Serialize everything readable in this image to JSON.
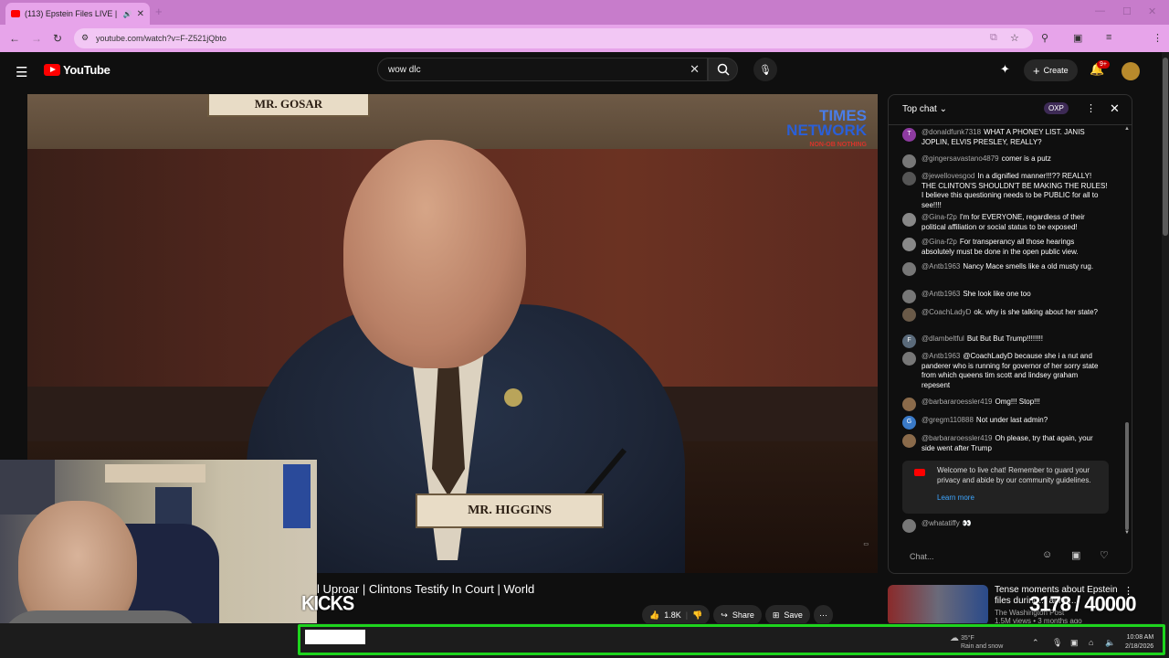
{
  "browser": {
    "tab_title": "(113) Epstein Files LIVE | Cli",
    "url": "youtube.com/watch?v=F-Z521jQbto"
  },
  "youtube": {
    "logo_text": "YouTube",
    "search_value": "wow dlc",
    "create_label": "Create",
    "notif_count": "9+"
  },
  "video": {
    "nameplate_top": "MR. GOSAR",
    "nameplate_bottom": "MR. HIGGINS",
    "brand_line1": "TIMES",
    "brand_line2": "NETWORK",
    "brand_tag": "NON-OB NOTHING"
  },
  "below_video": {
    "title": "l Uproar | Clintons Testify In Court | World",
    "overlay_label": "KICKS",
    "like_count": "1.8K",
    "share_label": "Share",
    "save_label": "Save"
  },
  "chat": {
    "header": "Top chat",
    "badge": "OXP",
    "input_placeholder": "Chat...",
    "messages": [
      {
        "initial": "T",
        "color": "#8e3ba1",
        "author": "@donaldfunk7318",
        "text": "WHAT A PHONEY LIST. JANIS JOPLIN, ELVIS PRESLEY, REALLY?"
      },
      {
        "initial": "",
        "color": "#777777",
        "author": "@gingersavastano4879",
        "text": "comer is a putz"
      },
      {
        "initial": "",
        "color": "#555555",
        "author": "@jewellovesgod",
        "text": "In a dignified manner!!!?? REALLY! THE CLINTON'S SHOULDN'T BE MAKING THE RULES! I believe this questioning needs to be PUBLIC for all to see!!!!"
      },
      {
        "initial": "",
        "color": "#888888",
        "author": "@Gina-f2p",
        "text": "I'm for EVERYONE, regardless of their political affiliation or social status to be exposed!"
      },
      {
        "initial": "",
        "color": "#888888",
        "author": "@Gina-f2p",
        "text": "For transperancy all those hearings absolutely must be done in the open public view."
      },
      {
        "initial": "",
        "color": "#777777",
        "author": "@Antb1963",
        "text": "Nancy Mace smells like a old musty rug."
      },
      {
        "initial": "",
        "color": "#777777",
        "author": "@Antb1963",
        "text": "She look like one too"
      },
      {
        "initial": "",
        "color": "#6a5a48",
        "author": "@CoachLadyD",
        "text": "ok. why is she talking about her state?"
      },
      {
        "initial": "F",
        "color": "#5a6a7a",
        "author": "@dlambeltful",
        "text": "But But But Trump!!!!!!!!"
      },
      {
        "initial": "",
        "color": "#777777",
        "author": "@Antb1963",
        "text": "@CoachLadyD because she i a nut and panderer who is running for governor of her sorry state from which queens tim scott and lindsey graham repesent"
      },
      {
        "initial": "",
        "color": "#8a6a4a",
        "author": "@barbararoessler419",
        "text": "Omg!!! Stop!!!"
      },
      {
        "initial": "G",
        "color": "#3a7ac8",
        "author": "@gregm110888",
        "text": "Not under last admin?"
      },
      {
        "initial": "",
        "color": "#8a6a4a",
        "author": "@barbararoessler419",
        "text": "Oh please, try that again, your side went after Trump"
      }
    ],
    "welcome_text": "Welcome to live chat! Remember to guard your privacy and abide by our community guidelines.",
    "learn_more": "Learn more",
    "last_author": "@whatatiffy",
    "last_text": "👀"
  },
  "recommended": {
    "title": "Tense moments about Epstein files during... al he...",
    "channel": "The Washington Post",
    "meta": "1.5M views • 3 months ago"
  },
  "overlay": {
    "counter": "3178 / 40000"
  },
  "taskbar": {
    "weather_temp": "35°F",
    "weather_desc": "Rain and snow",
    "time": "10:08 AM",
    "date": "2/18/2026"
  }
}
